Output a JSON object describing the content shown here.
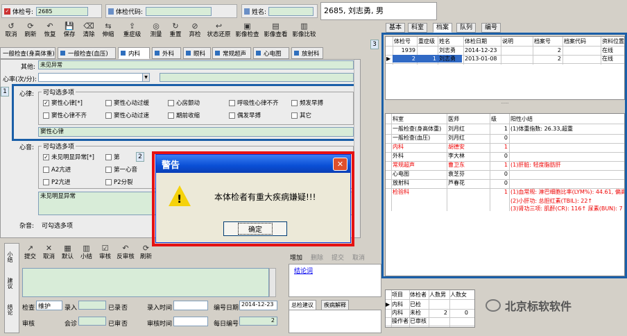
{
  "header": {
    "exam_no_label": "体检号:",
    "exam_no_value": "2685",
    "exam_code_label": "体检代码:",
    "name_label": "姓名:",
    "patient_info": "2685, 刘志勇, 男"
  },
  "toolbar": [
    "取消",
    "刷新",
    "恢复",
    "保存",
    "清除",
    "伸缩",
    "重症级",
    "测量",
    "重置",
    "弃检",
    "状态还原",
    "影像检查",
    "影像查看",
    "影像比较"
  ],
  "dept_tabs": [
    "一般检查(身高体重)",
    "一般检查(血压)",
    "内科",
    "外科",
    "眼科",
    "常规超声",
    "心电图",
    "放射科"
  ],
  "form": {
    "other_label": "其他:",
    "other_value": "未见异常",
    "heart_rate_label": "心率(次/分):",
    "rhythm_label": "心律:",
    "rhythm_group": "可勾选多项",
    "rhythm_options": [
      "窦性心律[*]",
      "窦性心动过缓",
      "心房颤动",
      "呼吸性心律不齐",
      "频发早搏",
      "窦性心律不齐",
      "窦性心动过速",
      "期前收缩",
      "偶发早搏",
      "其它"
    ],
    "rhythm_result": "窦性心律",
    "sound_label": "心音:",
    "sound_group": "可勾选多项",
    "sound_options": [
      "未见明显异常[*]",
      "第",
      "A2亢进",
      "第一心音",
      "P2亢进",
      "P2分裂"
    ],
    "sound_result": "未见明显异常",
    "murmur_label": "杂音:",
    "murmur_group": "可勾选多项"
  },
  "tags": {
    "t1": "1",
    "t2": "2",
    "t3": "3"
  },
  "dialog": {
    "title": "警告",
    "message": "本体检者有重大疾病嫌疑!!!",
    "ok": "确定",
    "close": "✕"
  },
  "lower_toolbar": [
    "提交",
    "取消",
    "默认",
    "小结",
    "审核",
    "反审核",
    "刷新"
  ],
  "lower_toolbar2": [
    "增加",
    "删除",
    "提交",
    "取消"
  ],
  "side_vtabs": [
    "小结",
    "建议",
    "结论"
  ],
  "conclusion_link": "结论词",
  "bottom": {
    "check_label": "检查",
    "check_value": "维护",
    "entry_label": "录入",
    "entered_label": "已录",
    "entered_value": "否",
    "entry_time_label": "录入时间",
    "serial_date_label": "编号日期",
    "serial_date_value": "2014-12-23",
    "audit_label": "审核",
    "consult_label": "会诊",
    "audited_label": "已审",
    "audited_value": "否",
    "audit_time_label": "审核时间",
    "daily_no_label": "每日编号",
    "daily_no_value": "2"
  },
  "bottom_tabs": [
    "总检建议",
    "疾病解释"
  ],
  "right_tabs": [
    "基本",
    "科室",
    "档案",
    "队列",
    "编号"
  ],
  "archive_table": {
    "headers": [
      "体检号",
      "重症级",
      "姓名",
      "体检日期",
      "说明",
      "档案号",
      "档案代码",
      "资料位置"
    ],
    "rows": [
      [
        "1939",
        "",
        "刘志勇",
        "2014-12-23",
        "",
        "2",
        "",
        "在线"
      ],
      [
        "2",
        "1",
        "刘志勇",
        "2013-01-08",
        "",
        "2",
        "",
        "在线"
      ]
    ]
  },
  "dept_table": {
    "headers": [
      "科室",
      "医师",
      "级",
      "阳性小结"
    ],
    "rows": [
      {
        "dept": "一般检查(身高体重)",
        "doctor": "刘月红",
        "level": "1",
        "summary": "(1)体重指数: 26.33,超重",
        "red": false
      },
      {
        "dept": "一般检查(血压)",
        "doctor": "刘月红",
        "level": "0",
        "summary": "",
        "red": false
      },
      {
        "dept": "内科",
        "doctor": "胡德安",
        "level": "1",
        "summary": "",
        "red": true
      },
      {
        "dept": "外科",
        "doctor": "李大林",
        "level": "0",
        "summary": "",
        "red": false
      },
      {
        "dept": "常规超声",
        "doctor": "曹卫东",
        "level": "1",
        "summary": "(1)肝脏: 轻度脂肪肝",
        "red": true
      },
      {
        "dept": "心电图",
        "doctor": "袁芝芬",
        "level": "0",
        "summary": "",
        "red": false
      },
      {
        "dept": "放射科",
        "doctor": "芦春花",
        "level": "0",
        "summary": "",
        "red": false
      },
      {
        "dept": "检验科",
        "doctor": "",
        "level": "1",
        "summary": "(1)血常规: 淋巴细胞比率(LYM%): 44.61, 偏高",
        "red": true
      }
    ],
    "extra_lines": [
      "(2)小肝功: 总胆红素(TBIL): 22↑",
      "(3)肾功三项: 肌酐(CR): 116↑ 尿素(BUN): 7"
    ]
  },
  "status_table": {
    "headers": [
      "项目",
      "体检者",
      "人数男",
      "人数女"
    ],
    "rows": [
      [
        "内科",
        "已检",
        "",
        ""
      ],
      [
        "内科",
        "未检",
        "2",
        "0"
      ],
      [
        "操作者",
        "已审核",
        "",
        ""
      ]
    ]
  },
  "watermark": "北京标软软件"
}
